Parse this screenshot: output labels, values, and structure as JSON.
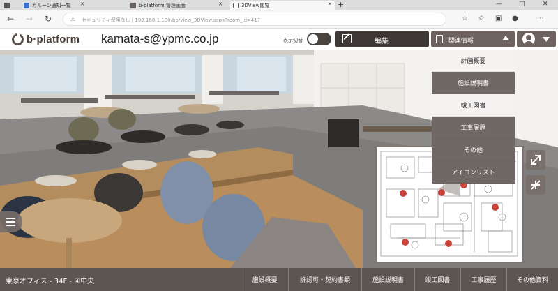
{
  "browser": {
    "tabs": [
      {
        "label": "ガルーン通知一覧",
        "active": false
      },
      {
        "label": "b-platform 管理画面",
        "active": false
      },
      {
        "label": "3DView閲覧",
        "active": true
      }
    ],
    "new_tab_label": "+",
    "url": "セキュリティ保護なし | 192.168.1.180/bp/view_3DView.aspx?room_id=417",
    "window_controls": [
      "—",
      "□",
      "✕"
    ]
  },
  "header": {
    "logo_text": "b·platform",
    "user_email": "kamata-s@ypmc.co.jp",
    "toggle_label": "表示切替",
    "edit_label": "編集",
    "related_label": "関連情報"
  },
  "dropdown": {
    "items": [
      {
        "label": "計画概要",
        "style": "light"
      },
      {
        "label": "施設説明書",
        "style": "dark"
      },
      {
        "label": "竣工図書",
        "style": "light"
      },
      {
        "label": "工事履歴",
        "style": "dark"
      },
      {
        "label": "その他",
        "style": "dark"
      },
      {
        "label": "アイコンリスト",
        "style": "dark"
      }
    ]
  },
  "minimap": {
    "pin_color": "#c8433a",
    "pin_count": 6
  },
  "footer": {
    "location": "東京オフィス - 34F - ④中央",
    "nav": [
      "施設概要",
      "許認可・契約書類",
      "施設説明書",
      "竣工図書",
      "工事履歴",
      "その他資料"
    ]
  },
  "colors": {
    "header_dark": "#3e3836",
    "accent_brown": "#6f6360",
    "footer_bg": "#5d5552"
  }
}
